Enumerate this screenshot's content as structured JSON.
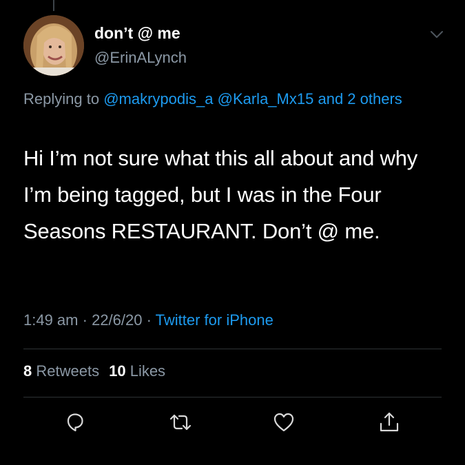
{
  "user": {
    "display_name": "don’t @ me",
    "handle": "@ErinALynch"
  },
  "reply": {
    "prefix": "Replying to ",
    "mention_1": "@makrypodis_a",
    "mention_2": "@Karla_Mx15",
    "others": "and 2 others"
  },
  "tweet": {
    "text": "Hi I’m not sure what this all about and why I’m being tagged, but I was in the Four Seasons RESTAURANT. Don’t @ me."
  },
  "meta": {
    "time": "1:49 am",
    "date": "22/6/20",
    "source": "Twitter for iPhone"
  },
  "stats": {
    "retweets_count": "8",
    "retweets_label": "Retweets",
    "likes_count": "10",
    "likes_label": "Likes"
  },
  "actions": [
    "reply-icon",
    "retweet-icon",
    "like-icon",
    "share-icon"
  ],
  "colors": {
    "background": "#000000",
    "text": "#ffffff",
    "secondary": "#8b98a5",
    "accent": "#1d9bf0",
    "divider": "#2f3336"
  }
}
